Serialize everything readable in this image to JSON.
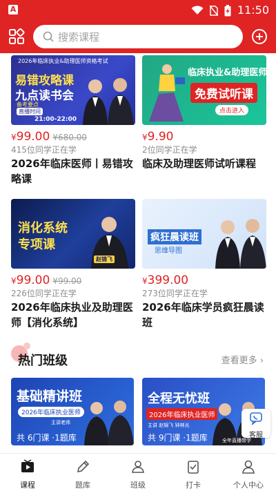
{
  "status": {
    "time": "11:50"
  },
  "search": {
    "placeholder": "搜索课程"
  },
  "courses": [
    {
      "price": "99.00",
      "orig": "¥680.00",
      "learners": "415位同学正在学",
      "title": "2026年临床医师丨易错攻略课",
      "thumb": {
        "top": "2026年临床执业&助理医师资格考试",
        "line1": "易错攻略课",
        "line2": "九点读书会",
        "sub": "备考要点",
        "time": "21:00-22:00",
        "live": "直播时间"
      }
    },
    {
      "price": "9.90",
      "orig": "",
      "learners": "2位同学正在学",
      "title": "临床及助理医师试听课程",
      "thumb": {
        "heading": "临床执业&助理医师",
        "badge": "免费试听课",
        "cta": "点击进入"
      }
    },
    {
      "price": "99.00",
      "orig": "¥99.00",
      "learners": "226位同学正在学",
      "title": "2026年临床执业及助理医师【消化系统】",
      "thumb": {
        "line1": "消化系统",
        "line2": "专项课",
        "name": "赵锦飞"
      }
    },
    {
      "price": "399.00",
      "orig": "",
      "learners": "273位同学正在学",
      "title": "2026年临床学员疯狂晨读班",
      "thumb": {
        "line1": "疯狂晨读班",
        "sub": "思维导图"
      }
    }
  ],
  "hot": {
    "title": "热门班级",
    "more": "查看更多",
    "classes": [
      {
        "title": "基础精讲班",
        "year": "2026年临床执业医师",
        "tag": "主讲老师",
        "count": "共 6门课 ·1题库"
      },
      {
        "title": "全程无忧班",
        "year": "2026年临床执业医师",
        "tag": "主讲 赵锦飞 钟林光",
        "count": "共 9门课 ·1题库",
        "extra": "全年直播带学"
      }
    ]
  },
  "service": {
    "label": "客服"
  },
  "tabs": [
    {
      "label": "课程",
      "icon": "play-icon",
      "active": true
    },
    {
      "label": "题库",
      "icon": "pencil-icon"
    },
    {
      "label": "班级",
      "icon": "class-icon"
    },
    {
      "label": "打卡",
      "icon": "checkin-icon"
    },
    {
      "label": "个人中心",
      "icon": "user-icon"
    }
  ],
  "colors": {
    "brand": "#e02323"
  }
}
